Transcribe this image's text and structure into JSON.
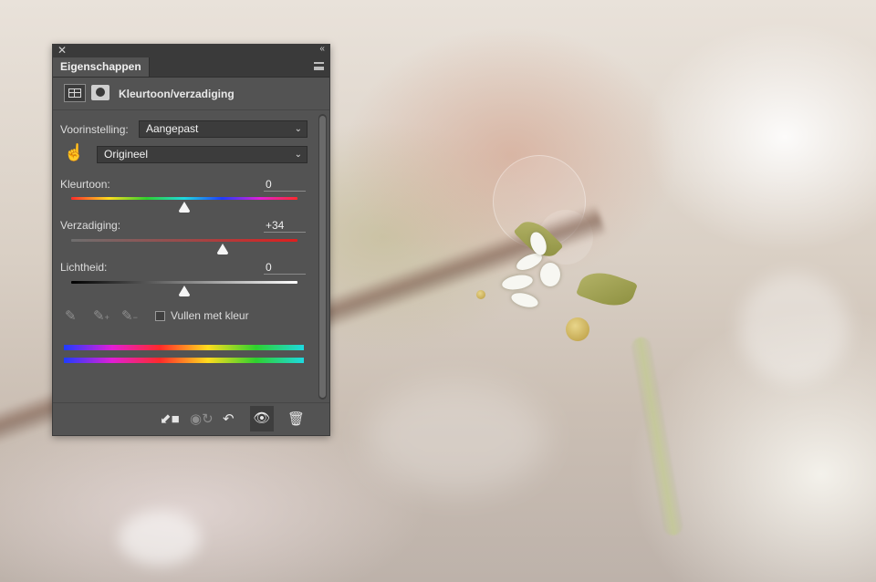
{
  "panel": {
    "tab_title": "Eigenschappen",
    "adjustment_title": "Kleurtoon/verzadiging"
  },
  "controls": {
    "preset_label": "Voorinstelling:",
    "preset_value": "Aangepast",
    "channel_value": "Origineel",
    "hue": {
      "label": "Kleurtoon:",
      "value": "0",
      "position_fraction": 0.5
    },
    "saturation": {
      "label": "Verzadiging:",
      "value": "+34",
      "position_fraction": 0.67
    },
    "lightness": {
      "label": "Lichtheid:",
      "value": "0",
      "position_fraction": 0.5
    },
    "colorize_label": "Vullen met kleur",
    "colorize_checked": false
  },
  "icons": {
    "close": "close-icon",
    "collapse": "double-chevron-icon",
    "panel_menu": "hamburger-menu-icon",
    "adjustment": "hue-saturation-adjustment-icon",
    "mask": "layer-mask-icon",
    "targeted_adjust": "hand-target-icon",
    "eyedropper": "eyedropper-icon",
    "eyedropper_plus": "eyedropper-plus-icon",
    "eyedropper_minus": "eyedropper-minus-icon",
    "clip": "clip-to-layer-icon",
    "view_previous": "view-previous-state-icon",
    "reset": "reset-icon",
    "visibility": "eye-icon",
    "delete": "trash-icon"
  },
  "colors": {
    "panel_bg": "#535353",
    "panel_dark": "#3a3a3a",
    "saturation_track_end": "#e01e1e"
  }
}
